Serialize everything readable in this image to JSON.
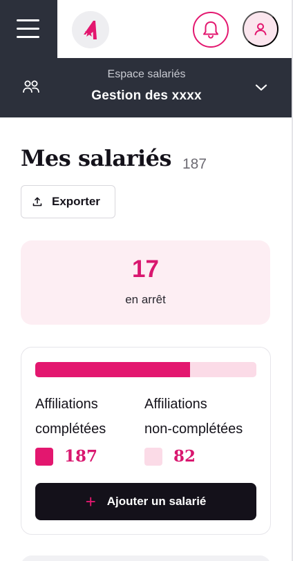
{
  "header": {
    "menu_icon": "hamburger-icon",
    "logo_icon": "brand-logo",
    "bell_icon": "bell-icon",
    "user_icon": "user-icon",
    "accent": "#e3176f",
    "dark": "#2c303b"
  },
  "workspace": {
    "subtitle": "Espace salariés",
    "title": "Gestion des xxxx",
    "icon": "people-icon",
    "chevron": "chevron-down-icon"
  },
  "page": {
    "title": "Mes salariés",
    "count": "187",
    "export_label": "Exporter",
    "export_icon": "upload-icon"
  },
  "stat": {
    "value": "17",
    "label": "en arrêt"
  },
  "affiliations": {
    "completed_fraction": 0.7,
    "completed": {
      "label_line1": "Affiliations",
      "label_line2": "complétées",
      "value": "187",
      "color": "#e3176f"
    },
    "incomplete": {
      "label_line1": "Affiliations",
      "label_line2": "non-complétées",
      "value": "82",
      "color": "#fbdbe7"
    },
    "add_label": "Ajouter un salarié",
    "add_icon": "plus-icon"
  }
}
